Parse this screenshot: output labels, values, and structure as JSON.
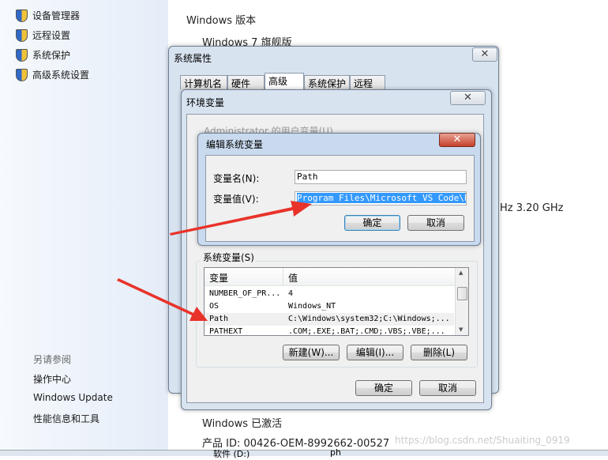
{
  "sidebar": {
    "items": [
      {
        "label": "设备管理器",
        "icon": "shield-icon"
      },
      {
        "label": "远程设置",
        "icon": "shield-icon"
      },
      {
        "label": "系统保护",
        "icon": "shield-icon"
      },
      {
        "label": "高级系统设置",
        "icon": "shield-icon"
      }
    ],
    "see_also": "另请参阅",
    "links": [
      "操作中心",
      "Windows Update",
      "性能信息和工具"
    ]
  },
  "background": {
    "edition_header": "Windows 版本",
    "edition": "Windows 7 旗舰版",
    "cpu_speed": "Hz   3.20 GHz",
    "activated": "Windows 已激活",
    "product_id": "产品 ID: 00426-OEM-8992662-00527",
    "taskbar_drive": "软件 (D:)",
    "taskbar_ph": "ph",
    "watermark": "https://blog.csdn.net/Shuaiting_0919"
  },
  "sys_props": {
    "title": "系统属性",
    "tabs": [
      "计算机名",
      "硬件",
      "高级",
      "系统保护",
      "远程"
    ],
    "selected_tab": "高级",
    "close": "✕"
  },
  "env_vars": {
    "title": "环境变量",
    "close": "✕",
    "user_vars_label": "Administrator 的用户变量(U)",
    "system_vars_label": "系统变量(S)",
    "columns": [
      "变量",
      "值"
    ],
    "rows": [
      {
        "name": "NUMBER_OF_PR...",
        "value": "4"
      },
      {
        "name": "OS",
        "value": "Windows_NT"
      },
      {
        "name": "Path",
        "value": "C:\\Windows\\system32;C:\\Windows;..."
      },
      {
        "name": "PATHEXT",
        "value": ".COM;.EXE;.BAT;.CMD;.VBS;.VBE;..."
      }
    ],
    "selected_row": "Path",
    "new_btn": "新建(W)...",
    "edit_btn": "编辑(I)...",
    "delete_btn": "删除(L)",
    "ok": "确定",
    "cancel": "取消"
  },
  "edit_var": {
    "title": "编辑系统变量",
    "close": "✕",
    "name_label": "变量名(N):",
    "name_value": "Path",
    "value_label": "变量值(V):",
    "value_value": "Program Files\\Microsoft VS Code\\bin",
    "ok": "确定",
    "cancel": "取消"
  },
  "colors": {
    "arrow": "#e8332a",
    "selection": "#3399ff"
  }
}
